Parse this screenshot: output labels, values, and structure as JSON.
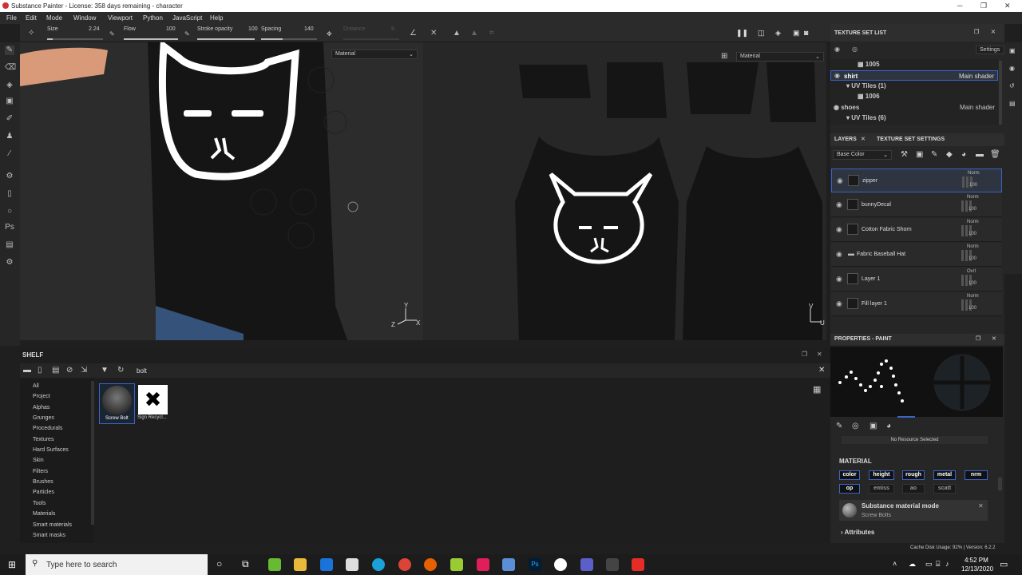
{
  "window": {
    "title": "Substance Painter - License: 358 days remaining - character"
  },
  "menu": [
    "File",
    "Edit",
    "Mode",
    "Window",
    "Viewport",
    "Python",
    "JavaScript",
    "Help"
  ],
  "toolbar": {
    "size_label": "Size",
    "size_value": "2.24",
    "flow_label": "Flow",
    "flow_value": "100",
    "stroke_label": "Stroke opacity",
    "stroke_value": "100",
    "spacing_label": "Spacing",
    "spacing_value": "140",
    "distance_label": "Distance",
    "distance_value": "8"
  },
  "viewport": {
    "material_left": "Material",
    "material_right": "Material"
  },
  "texture_set_list": {
    "title": "TEXTURE SET LIST",
    "settings": "Settings",
    "rows": [
      {
        "name": "1005",
        "shader": ""
      },
      {
        "name": "shirt",
        "shader": "Main shader"
      },
      {
        "name": "UV Tiles (1)",
        "shader": ""
      },
      {
        "name": "1006",
        "shader": ""
      },
      {
        "name": "shoes",
        "shader": "Main shader"
      },
      {
        "name": "UV Tiles (6)",
        "shader": ""
      }
    ]
  },
  "layers_panel": {
    "tab_layers": "LAYERS",
    "tab_settings": "TEXTURE SET SETTINGS",
    "channel": "Base Color",
    "layers": [
      {
        "name": "zipper",
        "blend": "Norm",
        "opacity": "100"
      },
      {
        "name": "bunnyDecal",
        "blend": "Norm",
        "opacity": "100"
      },
      {
        "name": "Cotton Fabric Shorn",
        "blend": "Norm",
        "opacity": "100"
      },
      {
        "name": "Fabric Baseball Hat",
        "blend": "Norm",
        "opacity": "100"
      },
      {
        "name": "Layer 1",
        "blend": "Ovrl",
        "opacity": "100"
      },
      {
        "name": "Fill layer 1",
        "blend": "Norm",
        "opacity": "100"
      }
    ]
  },
  "properties": {
    "title": "PROPERTIES - PAINT",
    "no_resource": "No Resource Selected",
    "material_label": "MATERIAL",
    "channels": [
      {
        "label": "color",
        "on": true
      },
      {
        "label": "height",
        "on": true
      },
      {
        "label": "rough",
        "on": true
      },
      {
        "label": "metal",
        "on": true
      },
      {
        "label": "nrm",
        "on": true
      },
      {
        "label": "op",
        "on": true
      },
      {
        "label": "emiss",
        "on": false
      },
      {
        "label": "ao",
        "on": false
      },
      {
        "label": "scatt",
        "on": false
      }
    ],
    "mode_title": "Substance material mode",
    "mode_value": "Screw Bolts",
    "attributes": "Attributes"
  },
  "shelf": {
    "title": "SHELF",
    "search": "bolt",
    "categories": [
      "All",
      "Project",
      "Alphas",
      "Grunges",
      "Procedurals",
      "Textures",
      "Hard Surfaces",
      "Skin",
      "Filters",
      "Brushes",
      "Particles",
      "Tools",
      "Materials",
      "Smart materials",
      "Smart masks"
    ],
    "items": [
      {
        "label": "Screw Bolt"
      },
      {
        "label": "Sign Recycl..."
      }
    ]
  },
  "statusbar": {
    "text": "Cache Disk Usage:   92% | Version: 6.2.2"
  },
  "taskbar": {
    "search": "Type here to search",
    "time": "4:52 PM",
    "date": "12/13/2020"
  },
  "colors": {
    "accent": "#3a64c8",
    "bg": "#1f1f1f",
    "panel": "#262626"
  }
}
